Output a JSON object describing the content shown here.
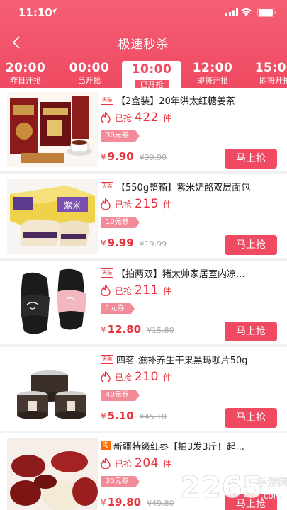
{
  "status": {
    "time": "11:10"
  },
  "nav": {
    "title": "极速秒杀"
  },
  "tabs": [
    {
      "time": "20:00",
      "label": "昨日开抢"
    },
    {
      "time": "00:00",
      "label": "已开抢"
    },
    {
      "time": "10:00",
      "label": "已开抢",
      "active": true
    },
    {
      "time": "12:00",
      "label": "即将开抢"
    },
    {
      "time": "15:00",
      "label": "即将开抢"
    }
  ],
  "items": [
    {
      "badge": "天猫",
      "name": "【2盒装】20年洪太红糖姜茶",
      "grabbed_label": "已抢",
      "grabbed": "422",
      "unit": "件",
      "coupon": "30元券",
      "currency": "¥",
      "price": "9.90",
      "old_price": "¥39.90",
      "buy": "马上抢"
    },
    {
      "badge": "天猫",
      "name": "【550g整箱】紫米奶酪双层面包",
      "grabbed_label": "已抢",
      "grabbed": "215",
      "unit": "件",
      "coupon": "10元券",
      "currency": "¥",
      "price": "9.99",
      "old_price": "¥19.99",
      "buy": "马上抢"
    },
    {
      "badge": "天猫",
      "name": "【拍两双】猪太帅家居室内凉...",
      "grabbed_label": "已抢",
      "grabbed": "211",
      "unit": "件",
      "coupon": "1元券",
      "currency": "¥",
      "price": "12.80",
      "old_price": "¥15.80",
      "buy": "马上抢"
    },
    {
      "badge": "天猫",
      "name": "四茗-滋补养生干果黑玛咖片50g",
      "grabbed_label": "已抢",
      "grabbed": "210",
      "unit": "件",
      "coupon": "40元券",
      "currency": "¥",
      "price": "5.10",
      "old_price": "¥45.10",
      "buy": "马上抢"
    },
    {
      "badge": "淘",
      "name": "新疆特级红枣【拍3发3斤！起...",
      "grabbed_label": "已抢",
      "grabbed": "204",
      "unit": "件",
      "coupon": "30元券",
      "currency": "¥",
      "price": "19.80",
      "old_price": "¥49.80",
      "buy": "马上抢"
    }
  ],
  "watermark": {
    "main": "2265",
    "sub": "手游网",
    "url": ".com"
  },
  "colors": {
    "accent": "#ef4a62",
    "coupon": "#f28a98",
    "price": "#e8323c"
  }
}
